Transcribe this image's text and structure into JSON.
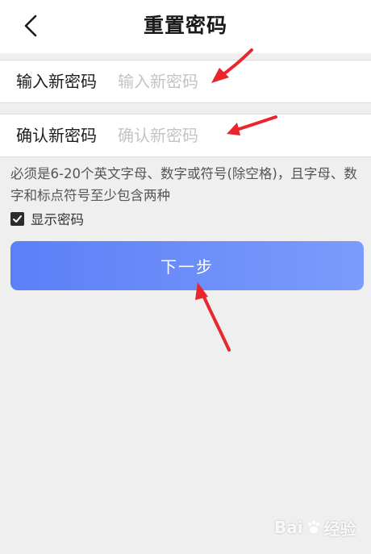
{
  "header": {
    "title": "重置密码",
    "back_icon": "chevron-left-icon"
  },
  "form": {
    "new_password": {
      "label": "输入新密码",
      "placeholder": "输入新密码",
      "value": ""
    },
    "confirm_password": {
      "label": "确认新密码",
      "placeholder": "确认新密码",
      "value": ""
    }
  },
  "rules": {
    "text": "必须是6-20个英文字母、数字或符号(除空格)，且字母、数字和标点符号至少包含两种"
  },
  "show_password": {
    "label": "显示密码",
    "checked": true
  },
  "next_button": {
    "label": "下一步"
  },
  "colors": {
    "button_gradient_start": "#5b7ff7",
    "button_gradient_end": "#7b9cfc",
    "annotation_arrow": "#e8262b",
    "background": "#efefef"
  },
  "watermark": {
    "brand_left": "Bai",
    "brand_right": "经验",
    "sub": ""
  }
}
